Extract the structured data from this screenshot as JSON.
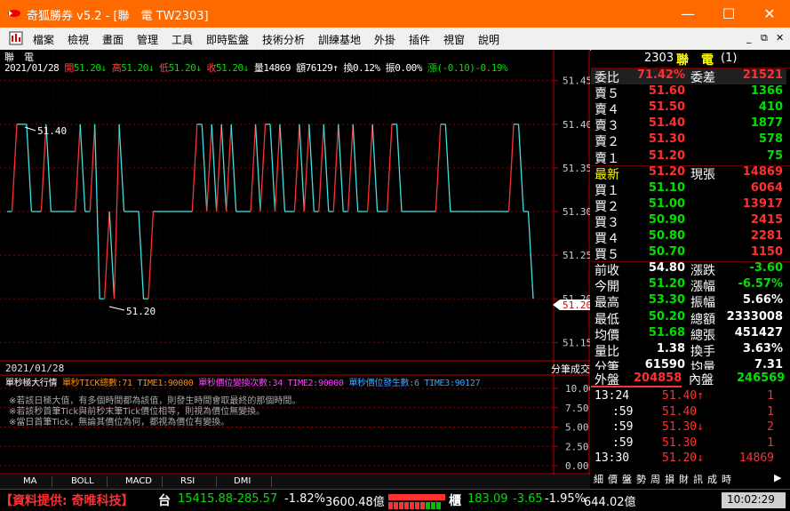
{
  "window": {
    "title": "奇狐勝券 v5.2 - [聯　電 TW2303]",
    "minimize": "—",
    "maximize": "☐",
    "close": "✕",
    "inner_min": "_",
    "inner_restore": "⧉",
    "inner_close": "✕"
  },
  "menu": [
    "檔案",
    "檢視",
    "畫面",
    "管理",
    "工具",
    "即時監盤",
    "技術分析",
    "訓練基地",
    "外掛",
    "插件",
    "視窗",
    "說明"
  ],
  "chart": {
    "stock_label": "聯　電",
    "date": "2021/01/28",
    "open_label": "開",
    "open": "51.20",
    "high_label": "高",
    "high": "51.20",
    "low_label": "低",
    "low": "51.20",
    "close_label": "收",
    "close": "51.20",
    "vol_label": "量",
    "vol": "14869",
    "amt_label": "額",
    "amt": "76129",
    "turn_label": "換",
    "turn": "0.12%",
    "amp_label": "振",
    "amp": "0.00%",
    "chg_label": "漲",
    "chg": "(-0.10)",
    "chg_pct": "-0.19%",
    "max_label": "51.40",
    "min_label": "51.20",
    "current_tag": "51.20",
    "y_ticks": [
      "51.45",
      "51.40",
      "51.35",
      "51.30",
      "51.25",
      "51.20",
      "51.15"
    ],
    "sub_date": "2021/01/28",
    "sub_axis_label": "分筆成交",
    "sub_ticks": [
      "10.00",
      "7.50",
      "5.00",
      "2.50",
      "0.00"
    ],
    "indicator_title": "單秒極大行情",
    "indicator_1": "單秒TICK總數:71 TIME1:90000",
    "indicator_2": "單秒價位變換次數:34 TIME2:90000",
    "indicator_3": "單秒價位發生數:6 TIME3:90127",
    "notes": [
      "※若該日極大值，有多個時間都為該值，則發生時間會取最終的那個時間。",
      "※若該秒首筆Tick與前秒末筆Tick價位相等，則視為價位無變換。",
      "※當日首筆Tick，無論其價位為何，都視為價位有變換。"
    ],
    "series_prices": [
      51.3,
      51.3,
      51.4,
      51.4,
      51.4,
      51.3,
      51.3,
      51.3,
      51.4,
      51.3,
      51.3,
      51.3,
      51.3,
      51.3,
      51.3,
      51.4,
      51.3,
      51.3,
      51.4,
      51.2,
      51.2,
      51.3,
      51.2,
      51.4,
      51.3,
      51.3,
      51.3,
      51.3,
      51.2,
      51.2,
      51.3,
      51.3,
      51.3,
      51.3,
      51.3,
      51.3,
      51.3,
      51.3,
      51.3,
      51.4,
      51.4,
      51.3,
      51.4,
      51.3,
      51.4,
      51.3,
      51.4,
      51.3,
      51.3,
      51.3,
      51.3,
      51.4,
      51.3,
      51.4,
      51.4,
      51.3,
      51.4,
      51.3,
      51.3,
      51.3,
      51.4,
      51.3,
      51.4,
      51.3,
      51.3,
      51.4,
      51.3,
      51.3,
      51.4,
      51.3,
      51.3,
      51.4,
      51.3,
      51.3,
      51.3,
      51.4,
      51.3,
      51.3,
      51.3,
      51.4,
      51.4,
      51.3,
      51.3,
      51.3,
      51.3,
      51.3,
      51.3,
      51.3,
      51.3,
      51.4,
      51.4,
      51.3,
      51.3,
      51.3,
      51.3,
      51.3,
      51.3,
      51.3,
      51.3,
      51.3,
      51.3,
      51.3,
      51.3,
      51.3,
      51.4,
      51.4,
      51.3,
      51.3,
      51.2
    ],
    "y_min": 51.135,
    "y_max": 51.465
  },
  "panel": {
    "code": "2303",
    "name": "聯　電",
    "suffix": "(1)",
    "rows": [
      {
        "l": "委比",
        "v": "71.42%",
        "l2": "委差",
        "v2": "21521",
        "vc": "red",
        "v2c": "red",
        "hdr": true
      },
      {
        "l": "賣５",
        "v": "51.60",
        "v2": "1366",
        "vc": "red",
        "v2c": "green"
      },
      {
        "l": "賣４",
        "v": "51.50",
        "v2": "410",
        "vc": "red",
        "v2c": "green"
      },
      {
        "l": "賣３",
        "v": "51.40",
        "v2": "1877",
        "vc": "red",
        "v2c": "green"
      },
      {
        "l": "賣２",
        "v": "51.30",
        "v2": "578",
        "vc": "red",
        "v2c": "green"
      },
      {
        "l": "賣１",
        "v": "51.20",
        "v2": "75",
        "vc": "red",
        "v2c": "green"
      },
      {
        "l": "最新",
        "v": "51.20",
        "l2": "現張",
        "v2": "14869",
        "vc": "red",
        "v2c": "red",
        "yellow": true
      },
      {
        "l": "買１",
        "v": "51.10",
        "v2": "6064",
        "vc": "green",
        "v2c": "red"
      },
      {
        "l": "買２",
        "v": "51.00",
        "v2": "13917",
        "vc": "green",
        "v2c": "red"
      },
      {
        "l": "買３",
        "v": "50.90",
        "v2": "2415",
        "vc": "green",
        "v2c": "red"
      },
      {
        "l": "買４",
        "v": "50.80",
        "v2": "2281",
        "vc": "green",
        "v2c": "red"
      },
      {
        "l": "買５",
        "v": "50.70",
        "v2": "1150",
        "vc": "green",
        "v2c": "red"
      },
      {
        "l": "前收",
        "v": "54.80",
        "l2": "漲跌",
        "v2": "-3.60",
        "vc": "white",
        "v2c": "green"
      },
      {
        "l": "今開",
        "v": "51.20",
        "l2": "漲幅",
        "v2": "-6.57%",
        "vc": "green",
        "v2c": "green"
      },
      {
        "l": "最高",
        "v": "53.30",
        "l2": "振幅",
        "v2": "5.66%",
        "vc": "green",
        "v2c": "white"
      },
      {
        "l": "最低",
        "v": "50.20",
        "l2": "總額",
        "v2": "2333008",
        "vc": "green",
        "v2c": "white"
      },
      {
        "l": "均價",
        "v": "51.68",
        "l2": "總張",
        "v2": "451427",
        "vc": "green",
        "v2c": "white"
      },
      {
        "l": "量比",
        "v": "1.38",
        "l2": "換手",
        "v2": "3.63%",
        "vc": "white",
        "v2c": "white"
      },
      {
        "l": "分筆",
        "v": "61590",
        "l2": "均量",
        "v2": "7.31",
        "vc": "white",
        "v2c": "white"
      }
    ],
    "outer_label": "外盤",
    "outer_val": "204858",
    "inner_label": "內盤",
    "inner_val": "246569",
    "outer_ratio": 0.4538,
    "ticks": [
      {
        "t": "13:24",
        "p": "51.40↑",
        "q": "1",
        "pc": "red",
        "qc": "red"
      },
      {
        "t": ":59",
        "p": "51.40",
        "q": "1",
        "pc": "red",
        "qc": "red"
      },
      {
        "t": ":59",
        "p": "51.30↓",
        "q": "2",
        "pc": "red",
        "qc": "red"
      },
      {
        "t": ":59",
        "p": "51.30",
        "q": "1",
        "pc": "red",
        "qc": "red"
      },
      {
        "t": "13:30",
        "p": "51.20↓",
        "q": "14869",
        "pc": "red",
        "qc": "red"
      }
    ],
    "bottom_tabs": [
      "細",
      "價",
      "盤",
      "勢",
      "周",
      "損",
      "財",
      "訊",
      "成",
      "時"
    ],
    "bottom_arrow": "▶"
  },
  "tabs": [
    "MA",
    "BOLL",
    "MACD",
    "RSI",
    "DMI"
  ],
  "ticker": {
    "provider": "【資料提供: 奇唯科技】",
    "tw_label": "台",
    "tw_index": "15415.88",
    "tw_chg": "-285.57",
    "tw_pct": "-1.82%",
    "tw_amt": "3600.48億",
    "otc_label": "櫃",
    "otc_index": "183.09",
    "otc_chg": "-3.65",
    "otc_pct": "-1.95%",
    "otc_amt": "644.02億",
    "clock": "10:02:29"
  }
}
